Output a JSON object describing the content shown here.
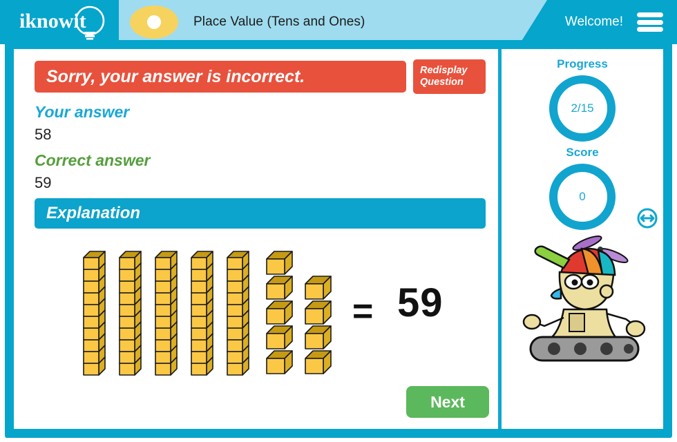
{
  "header": {
    "logo_text": "iknowit",
    "logo_icon": "lightbulb-icon",
    "topic_icon": "yellow-dot-icon",
    "lesson_title": "Place Value (Tens and Ones)",
    "welcome_text": "Welcome!",
    "menu_icon": "hamburger-menu-icon",
    "brand_color": "#05a5cc",
    "pill_color": "#9fdcef",
    "accent_yellow": "#f6d35e"
  },
  "main": {
    "result_message": "Sorry, your answer is incorrect.",
    "result_color": "#e8513c",
    "redisplay_label": "Redisplay\nQuestion",
    "your_answer_label": "Your answer",
    "your_answer_value": "58",
    "your_answer_color": "#1aa7d6",
    "correct_answer_label": "Correct answer",
    "correct_answer_value": "59",
    "correct_answer_color": "#569e3d",
    "explanation_label": "Explanation",
    "explanation_color": "#0ca3cc",
    "equals_sign": "=",
    "total_value": "59",
    "next_label": "Next",
    "next_color": "#5cb85c"
  },
  "blocks": {
    "tens_rods": 5,
    "cubes_per_rod": 10,
    "ones_cubes": 9,
    "ones_left_column": 5,
    "ones_right_column": 4,
    "cube_face_color": "#fbc846",
    "cube_top_color": "#c69a14",
    "cube_side_color": "#dcae22",
    "outline_color": "#1a1a1a"
  },
  "sidebar": {
    "progress_label": "Progress",
    "progress_value": "2/15",
    "score_label": "Score",
    "score_value": "0",
    "ring_color": "#11a4ce",
    "mascot_icon": "robot-mascot-icon",
    "resize_icon": "resize-horizontal-icon"
  }
}
